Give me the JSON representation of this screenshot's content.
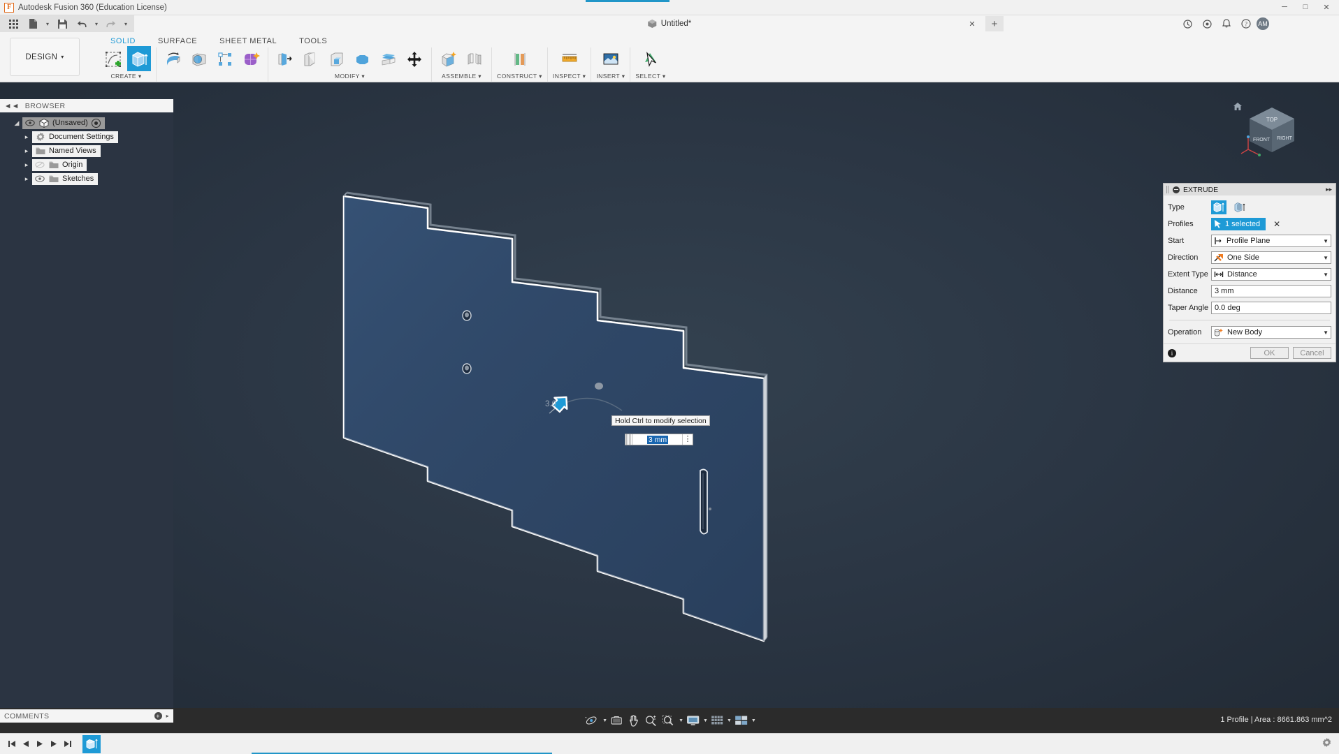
{
  "titlebar": {
    "app_title": "Autodesk Fusion 360 (Education License)",
    "logo_letter": "F"
  },
  "quick_access": {
    "grid_icon": "app-grid-icon",
    "new_label": "new-file-icon",
    "save_label": "save-icon",
    "undo_label": "undo-icon",
    "redo_label": "redo-icon",
    "document_tab": "Untitled*",
    "close_tab": "✕",
    "add_tab": "+",
    "right_icons": [
      "jobs-icon",
      "extensions-icon",
      "notifications-icon",
      "help-icon"
    ],
    "avatar_initials": "AM"
  },
  "window_controls": {
    "minimize": "─",
    "maximize": "□",
    "close": "✕"
  },
  "ribbon": {
    "design_selector": "DESIGN",
    "design_caret": "▾",
    "tabs": [
      {
        "label": "SOLID",
        "active": true
      },
      {
        "label": "SURFACE",
        "active": false
      },
      {
        "label": "SHEET METAL",
        "active": false
      },
      {
        "label": "TOOLS",
        "active": false
      }
    ],
    "panels": [
      {
        "label": "CREATE ▾",
        "tools": [
          "sketch-icon",
          "extrude-icon"
        ]
      },
      {
        "label": "",
        "tools": [
          "revolve-icon",
          "sweep-icon",
          "pattern-icon",
          "form-icon"
        ]
      },
      {
        "label": "MODIFY ▾",
        "tools": [
          "press-pull-icon",
          "fillet-icon",
          "shell-icon",
          "combine-icon",
          "split-face-icon",
          "move-copy-icon"
        ]
      },
      {
        "label": "ASSEMBLE ▾",
        "tools": [
          "new-component-icon",
          "joint-icon"
        ]
      },
      {
        "label": "CONSTRUCT ▾",
        "tools": [
          "offset-plane-icon"
        ]
      },
      {
        "label": "INSPECT ▾",
        "tools": [
          "measure-icon"
        ]
      },
      {
        "label": "INSERT ▾",
        "tools": [
          "insert-mcmaster-icon"
        ]
      },
      {
        "label": "SELECT ▾",
        "tools": [
          "select-icon"
        ]
      }
    ]
  },
  "browser": {
    "header": "BROWSER",
    "collapse_icon": "collapse-left-icon",
    "items": [
      {
        "label": "(Unsaved)",
        "icon": "document-cube-icon",
        "eye": true,
        "root": true,
        "arrow": "◢",
        "radio": true
      },
      {
        "label": "Document Settings",
        "icon": "gear-icon",
        "eye": false,
        "arrow": "▶"
      },
      {
        "label": "Named Views",
        "icon": "folder-icon",
        "eye": false,
        "arrow": "▶"
      },
      {
        "label": "Origin",
        "icon": "folder-icon",
        "eye": true,
        "eye_off": true,
        "arrow": "▶"
      },
      {
        "label": "Sketches",
        "icon": "folder-icon",
        "eye": true,
        "arrow": "▶"
      }
    ]
  },
  "canvas": {
    "dimension_label": "3.0",
    "tooltip": "Hold Ctrl to modify selection",
    "input_value": "3 mm",
    "input_menu_icon": "kebab-menu-icon",
    "manipulator_icon": "arrow-drag-handle-icon",
    "viewcube_labels": {
      "top": "TOP",
      "front": "FRONT",
      "right": "RIGHT"
    },
    "home_icon": "home-icon"
  },
  "extrude_dialog": {
    "title": "EXTRUDE",
    "collapse_icon": "minimize-icon",
    "expand_icon": "▸▸",
    "rows": [
      {
        "label": "Type",
        "kind": "type-toggle",
        "options": [
          "extrude-solid-icon",
          "extrude-thin-icon"
        ],
        "selected": 0
      },
      {
        "label": "Profiles",
        "kind": "selection",
        "value": "1 selected",
        "icon": "cursor-arrow-icon",
        "clear": "✕"
      },
      {
        "label": "Start",
        "kind": "select",
        "value": "Profile Plane",
        "icon": "profile-plane-icon"
      },
      {
        "label": "Direction",
        "kind": "select",
        "value": "One Side",
        "icon": "one-side-icon"
      },
      {
        "label": "Extent Type",
        "kind": "select",
        "value": "Distance",
        "icon": "distance-icon"
      },
      {
        "label": "Distance",
        "kind": "input",
        "value": "3 mm"
      },
      {
        "label": "Taper Angle",
        "kind": "input",
        "value": "0.0 deg"
      },
      {
        "label": "Operation",
        "kind": "select",
        "value": "New Body",
        "icon": "new-body-icon"
      }
    ],
    "info_icon": "info-icon",
    "ok_label": "OK",
    "cancel_label": "Cancel"
  },
  "comments_panel": {
    "label": "COMMENTS",
    "add_icon": "add-comment-icon",
    "caret": "▸"
  },
  "navbar": {
    "tools": [
      {
        "name": "orbit-icon",
        "caret": true
      },
      {
        "name": "look-at-icon",
        "caret": false
      },
      {
        "name": "pan-icon",
        "caret": false
      },
      {
        "name": "zoom-icon",
        "caret": false
      },
      {
        "name": "zoom-window-icon",
        "caret": true
      },
      {
        "name": "display-settings-icon",
        "caret": true
      },
      {
        "name": "grid-snaps-icon",
        "caret": true
      },
      {
        "name": "viewports-icon",
        "caret": true
      }
    ],
    "status": "1 Profile | Area : 8661.863 mm^2"
  },
  "timeline": {
    "controls": [
      "skip-start-icon",
      "step-back-icon",
      "play-icon",
      "step-forward-icon",
      "skip-end-icon"
    ],
    "feature": "extrude-feature-icon",
    "settings_icon": "gear-icon"
  },
  "colors": {
    "accent_blue": "#1e9ad6",
    "canvas_dark": "#2b3644",
    "model_face": "#2f4766",
    "model_edge": "#ffffff",
    "selection_blue": "#1966b0",
    "ribbon_bg": "#f4f4f4",
    "panel_bg": "#f1f1f1",
    "navbar_bg": "#2b2b2b"
  }
}
